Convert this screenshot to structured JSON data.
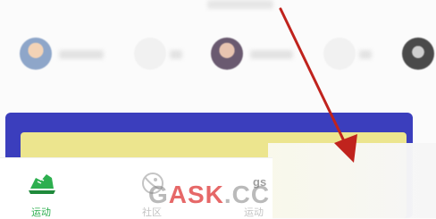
{
  "tabs": [
    {
      "label": "运动",
      "icon": "running-shoe-icon",
      "active": true
    },
    {
      "label": "社区",
      "icon": "planet-icon",
      "active": false
    },
    {
      "label": "运动",
      "icon": "partial-icon",
      "active": false
    }
  ],
  "watermark": {
    "text_gray": "G",
    "text_red": "ASK",
    "text_tail": ".CC",
    "small": "gs"
  },
  "colors": {
    "active_tab": "#2daf4f",
    "inactive_tab": "#c4c4c4",
    "banner_border": "#3b3ebd",
    "banner_fill": "#ece58e",
    "arrow": "#c0231d"
  }
}
